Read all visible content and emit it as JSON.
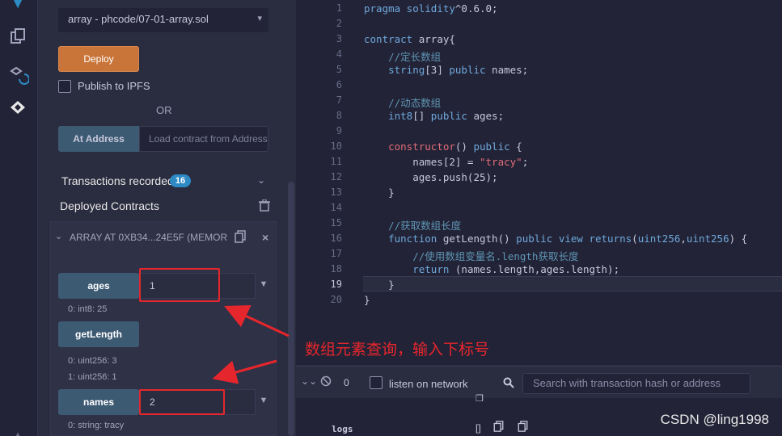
{
  "deploy": {
    "contract_select_value": "array - phcode/07-01-array.sol",
    "deploy_label": "Deploy",
    "publish_ipfs_label": "Publish to IPFS",
    "or_label": "OR",
    "at_address_label": "At Address",
    "at_address_placeholder": "Load contract from Address"
  },
  "transactions": {
    "label": "Transactions recorded",
    "count": "16"
  },
  "deployed": {
    "label": "Deployed Contracts",
    "instance_title": "ARRAY AT 0XB34...24E5F (MEMOR",
    "functions": [
      {
        "name": "ages",
        "input": "1",
        "results": [
          "0: int8: 25"
        ]
      },
      {
        "name": "getLength",
        "input": "",
        "results": [
          "0: uint256: 3",
          "1: uint256: 1"
        ]
      },
      {
        "name": "names",
        "input": "2",
        "results": [
          "0: string: tracy"
        ]
      }
    ]
  },
  "editor": {
    "line_numbers": [
      "1",
      "2",
      "3",
      "4",
      "5",
      "6",
      "7",
      "8",
      "9",
      "10",
      "11",
      "12",
      "13",
      "14",
      "15",
      "16",
      "17",
      "18",
      "19",
      "20"
    ],
    "active_line": 19
  },
  "terminal": {
    "count": "0",
    "listen_label": "listen on network",
    "search_placeholder": "Search with transaction hash or address",
    "logs_label": "logs",
    "logs_value": "[]"
  },
  "annotation": "数组元素查询，输入下标号",
  "watermark": "CSDN @ling1998",
  "colors": {
    "accent_deploy": "#c97539",
    "fn_button": "#3d5a73",
    "annotation_red": "#e6262d",
    "badge_blue": "#2d8ac5"
  }
}
